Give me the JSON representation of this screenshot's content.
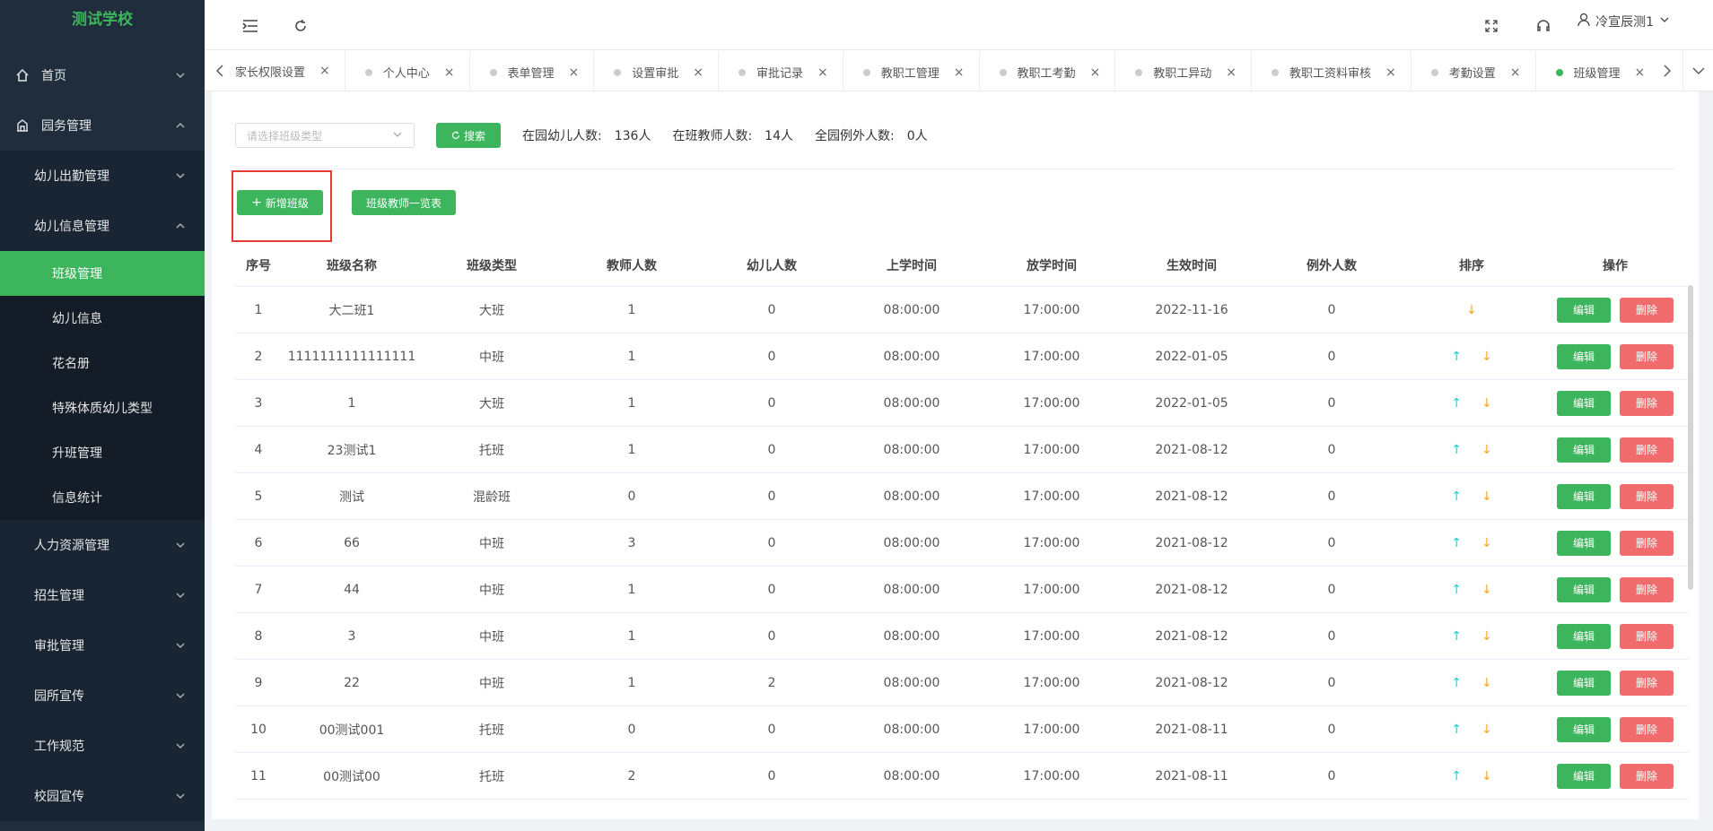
{
  "app": {
    "title": "测试学校"
  },
  "sidebar": {
    "items": [
      {
        "label": "首页"
      },
      {
        "label": "园务管理"
      }
    ],
    "sub": [
      {
        "label": "幼儿出勤管理"
      },
      {
        "label": "幼儿信息管理"
      }
    ],
    "subsub": [
      {
        "label": "班级管理"
      },
      {
        "label": "幼儿信息"
      },
      {
        "label": "花名册"
      },
      {
        "label": "特殊体质幼儿类型"
      },
      {
        "label": "升班管理"
      },
      {
        "label": "信息统计"
      }
    ],
    "rest": [
      {
        "label": "人力资源管理"
      },
      {
        "label": "招生管理"
      },
      {
        "label": "审批管理"
      },
      {
        "label": "园所宣传"
      },
      {
        "label": "工作规范"
      },
      {
        "label": "校园宣传"
      }
    ]
  },
  "header": {
    "user": "冷宣辰测1"
  },
  "tabs": [
    {
      "label": "家长权限设置",
      "active": false
    },
    {
      "label": "个人中心",
      "active": false
    },
    {
      "label": "表单管理",
      "active": false
    },
    {
      "label": "设置审批",
      "active": false
    },
    {
      "label": "审批记录",
      "active": false
    },
    {
      "label": "教职工管理",
      "active": false
    },
    {
      "label": "教职工考勤",
      "active": false
    },
    {
      "label": "教职工异动",
      "active": false
    },
    {
      "label": "教职工资料审核",
      "active": false
    },
    {
      "label": "考勤设置",
      "active": false
    },
    {
      "label": "班级管理",
      "active": true
    }
  ],
  "toolbar": {
    "select_placeholder": "请选择班级类型",
    "search": "搜索",
    "stats": [
      {
        "label": "在园幼儿人数:",
        "value": "136人"
      },
      {
        "label": "在班教师人数:",
        "value": "14人"
      },
      {
        "label": "全园例外人数:",
        "value": "0人"
      }
    ],
    "add": "新增班级",
    "teacher_list": "班级教师一览表"
  },
  "table": {
    "headers": [
      "序号",
      "班级名称",
      "班级类型",
      "教师人数",
      "幼儿人数",
      "上学时间",
      "放学时间",
      "生效时间",
      "例外人数",
      "排序",
      "操作"
    ],
    "edit": "编辑",
    "delete": "删除",
    "rows": [
      [
        "1",
        "大二班1",
        "大班",
        "1",
        "0",
        "08:00:00",
        "17:00:00",
        "2022-11-16",
        "0"
      ],
      [
        "2",
        "1111111111111111",
        "中班",
        "1",
        "0",
        "08:00:00",
        "17:00:00",
        "2022-01-05",
        "0"
      ],
      [
        "3",
        "1",
        "大班",
        "1",
        "0",
        "08:00:00",
        "17:00:00",
        "2022-01-05",
        "0"
      ],
      [
        "4",
        "23测试1",
        "托班",
        "1",
        "0",
        "08:00:00",
        "17:00:00",
        "2021-08-12",
        "0"
      ],
      [
        "5",
        "测试",
        "混龄班",
        "0",
        "0",
        "08:00:00",
        "17:00:00",
        "2021-08-12",
        "0"
      ],
      [
        "6",
        "66",
        "中班",
        "3",
        "0",
        "08:00:00",
        "17:00:00",
        "2021-08-12",
        "0"
      ],
      [
        "7",
        "44",
        "中班",
        "1",
        "0",
        "08:00:00",
        "17:00:00",
        "2021-08-12",
        "0"
      ],
      [
        "8",
        "3",
        "中班",
        "1",
        "0",
        "08:00:00",
        "17:00:00",
        "2021-08-12",
        "0"
      ],
      [
        "9",
        "22",
        "中班",
        "1",
        "2",
        "08:00:00",
        "17:00:00",
        "2021-08-12",
        "0"
      ],
      [
        "10",
        "00测试001",
        "托班",
        "0",
        "0",
        "08:00:00",
        "17:00:00",
        "2021-08-11",
        "0"
      ],
      [
        "11",
        "00测试00",
        "托班",
        "2",
        "0",
        "08:00:00",
        "17:00:00",
        "2021-08-11",
        "0"
      ]
    ]
  },
  "colors": {
    "accent": "#3cb55c",
    "danger": "#f06b6b",
    "sidebar": "#1f2d3d"
  }
}
